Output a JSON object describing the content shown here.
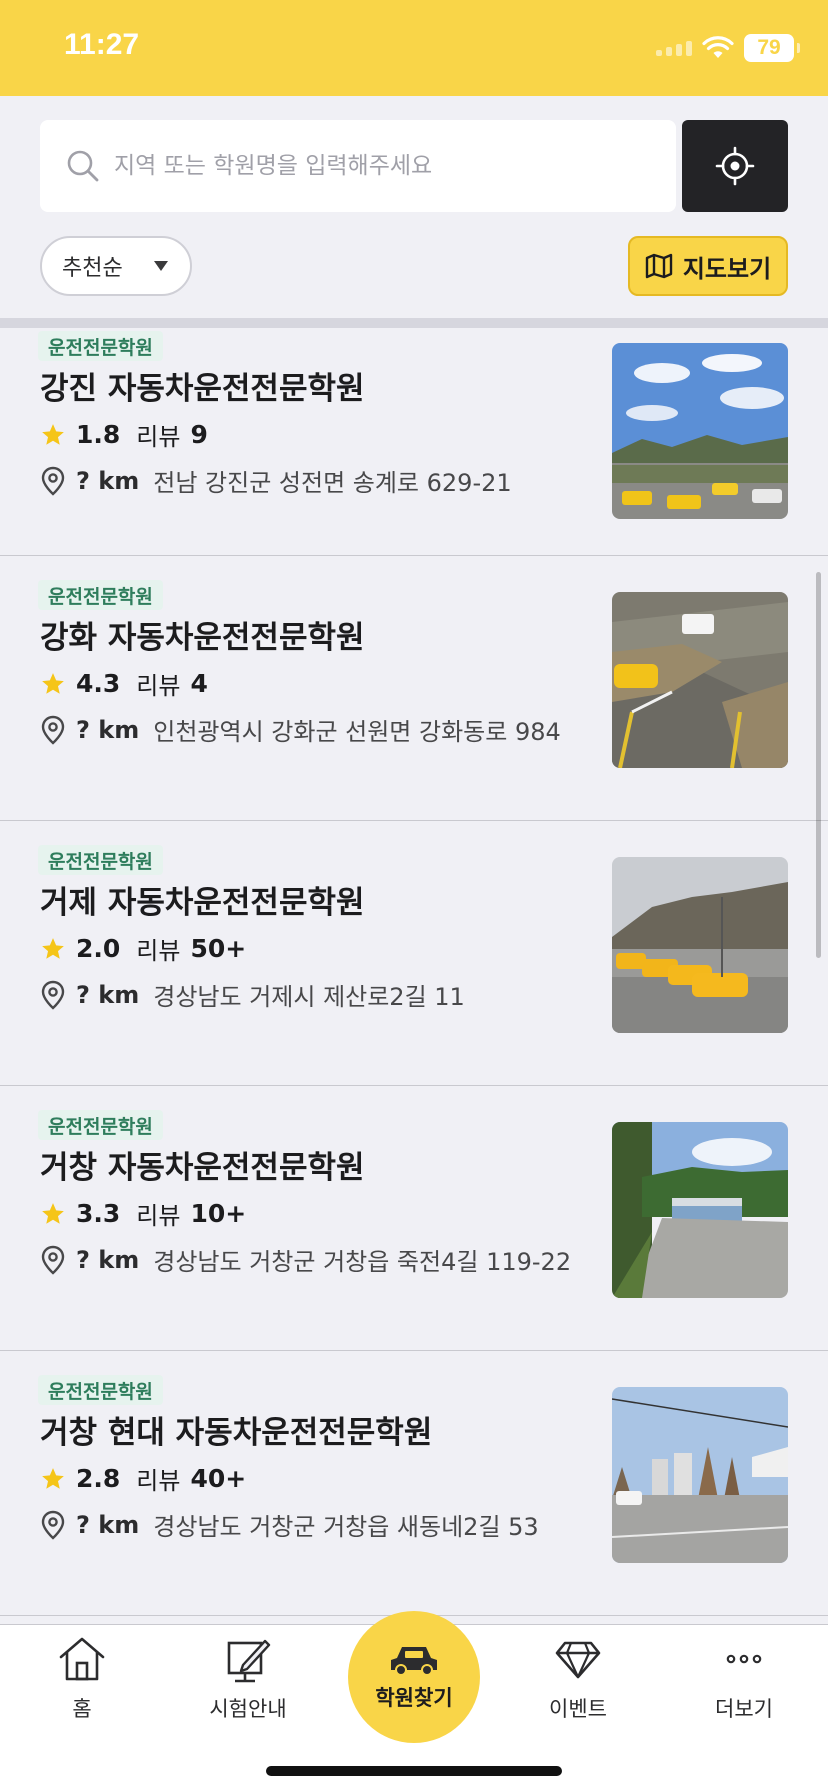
{
  "status_bar": {
    "time": "11:27",
    "battery": "79"
  },
  "search": {
    "placeholder": "지역 또는 학원명을 입력해주세요"
  },
  "filters": {
    "sort_label": "추천순",
    "map_label": "지도보기"
  },
  "academies": [
    {
      "badge": "운전전문학원",
      "name": "강진 자동차운전전문학원",
      "rating": "1.8",
      "review_label": "리뷰",
      "review_count": "9",
      "distance": "? km",
      "address": "전남 강진군 성전면 송계로 629-21"
    },
    {
      "badge": "운전전문학원",
      "name": "강화 자동차운전전문학원",
      "rating": "4.3",
      "review_label": "리뷰",
      "review_count": "4",
      "distance": "? km",
      "address": "인천광역시 강화군 선원면 강화동로 984"
    },
    {
      "badge": "운전전문학원",
      "name": "거제 자동차운전전문학원",
      "rating": "2.0",
      "review_label": "리뷰",
      "review_count": "50+",
      "distance": "? km",
      "address": "경상남도 거제시 제산로2길 11"
    },
    {
      "badge": "운전전문학원",
      "name": "거창 자동차운전전문학원",
      "rating": "3.3",
      "review_label": "리뷰",
      "review_count": "10+",
      "distance": "? km",
      "address": "경상남도 거창군 거창읍 죽전4길 119-22"
    },
    {
      "badge": "운전전문학원",
      "name": "거창 현대 자동차운전전문학원",
      "rating": "2.8",
      "review_label": "리뷰",
      "review_count": "40+",
      "distance": "? km",
      "address": "경상남도 거창군 거창읍 새동네2길 53"
    }
  ],
  "tabs": [
    {
      "label": "홈",
      "icon": "home-icon"
    },
    {
      "label": "시험안내",
      "icon": "edit-icon"
    },
    {
      "label": "학원찾기",
      "icon": "car-icon"
    },
    {
      "label": "이벤트",
      "icon": "diamond-icon"
    },
    {
      "label": "더보기",
      "icon": "more-icon"
    }
  ],
  "colors": {
    "brand_yellow": "#f9d548",
    "badge_green": "#2e7d5c",
    "star": "#f5c518",
    "dark_button": "#232326"
  }
}
